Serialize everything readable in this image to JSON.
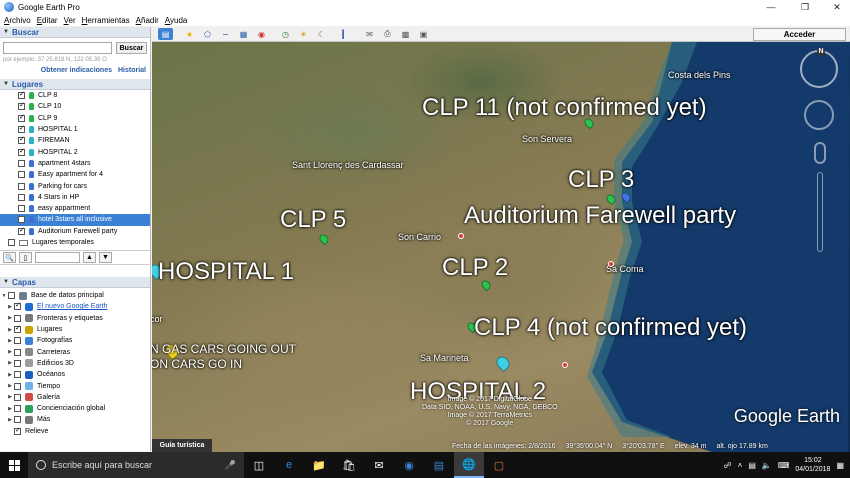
{
  "window": {
    "title": "Google Earth Pro"
  },
  "menu": [
    "Archivo",
    "Editar",
    "Ver",
    "Herramientas",
    "Añadir",
    "Ayuda"
  ],
  "search": {
    "header": "Buscar",
    "value": "",
    "button": "Buscar",
    "hint": "por ejemplo: 37 25.818 N, 122 05.36 O",
    "link_directions": "Obtener indicaciones",
    "link_history": "Historial"
  },
  "places": {
    "header": "Lugares",
    "items": [
      {
        "label": "CLP 8",
        "checked": true,
        "icon": "green-pin-icon"
      },
      {
        "label": "CLP 10",
        "checked": true,
        "icon": "green-pin-icon"
      },
      {
        "label": "CLP 9",
        "checked": true,
        "icon": "green-pin-icon"
      },
      {
        "label": "HOSPITAL 1",
        "checked": true,
        "icon": "teal-pin-icon"
      },
      {
        "label": "FIREMAN",
        "checked": true,
        "icon": "teal-pin-icon"
      },
      {
        "label": "HOSPITAL 2",
        "checked": true,
        "icon": "teal-pin-icon"
      },
      {
        "label": "apartment 4stars",
        "checked": false,
        "icon": "blue-pin-icon"
      },
      {
        "label": "Easy apartment for 4",
        "checked": false,
        "icon": "blue-pin-icon"
      },
      {
        "label": "Parking for cars",
        "checked": false,
        "icon": "blue-pin-icon"
      },
      {
        "label": "4 Stars in HP",
        "checked": false,
        "icon": "blue-pin-icon"
      },
      {
        "label": "easy appartment",
        "checked": false,
        "icon": "blue-pin-icon"
      },
      {
        "label": "hotel 3stars all inclusive",
        "checked": false,
        "icon": "blue-pin-icon",
        "selected": true
      },
      {
        "label": "Auditorium Farewell party",
        "checked": true,
        "icon": "blue-pin-icon"
      }
    ],
    "temp_folder": "Lugares temporales"
  },
  "layers": {
    "header": "Capas",
    "items": [
      {
        "label": "Base de datos principal",
        "checked": false,
        "icon": "database-icon",
        "link": false
      },
      {
        "label": "El nuevo Google Earth",
        "checked": true,
        "icon": "earth-icon",
        "link": true
      },
      {
        "label": "Fronteras y etiquetas",
        "checked": false,
        "icon": "borders-icon",
        "link": false
      },
      {
        "label": "Lugares",
        "checked": true,
        "icon": "places-icon",
        "link": false
      },
      {
        "label": "Fotografías",
        "checked": false,
        "icon": "photos-icon",
        "link": false
      },
      {
        "label": "Carreteras",
        "checked": false,
        "icon": "roads-icon",
        "link": false
      },
      {
        "label": "Edificios 3D",
        "checked": false,
        "icon": "buildings-icon",
        "link": false
      },
      {
        "label": "Océanos",
        "checked": false,
        "icon": "oceans-icon",
        "link": false
      },
      {
        "label": "Tiempo",
        "checked": false,
        "icon": "weather-icon",
        "link": false
      },
      {
        "label": "Galería",
        "checked": false,
        "icon": "gallery-icon",
        "link": false
      },
      {
        "label": "Concienciación global",
        "checked": false,
        "icon": "awareness-icon",
        "link": false
      },
      {
        "label": "Más",
        "checked": false,
        "icon": "more-icon",
        "link": false
      },
      {
        "label": "Relieve",
        "checked": true,
        "icon": "",
        "link": false
      }
    ]
  },
  "toolbar": {
    "signin": "Acceder"
  },
  "map": {
    "labels": {
      "clp11": "CLP 11 (not confirmed yet)",
      "clp3": "CLP 3",
      "auditorium": "Auditorium Farewell party",
      "clp5": "CLP 5",
      "hospital1": "HOSPITAL 1",
      "clp2": "CLP 2",
      "clp4": "CLP 4 (not confirmed yet)",
      "hospital2": "HOSPITAL 2",
      "cars_line1": "N GAS CARS GOING OUT",
      "cars_line2": "ON CARS GO IN",
      "fragment_cor": "cor"
    },
    "towns": {
      "costa": "Costa dels Pins",
      "son_servera": "Son Servera",
      "sant_llorenc": "Sant Llorenç des Cardassar",
      "son_carrio": "Son Carrio",
      "sa_coma": "Sa Coma",
      "sa_marineta": "Sa Marineta"
    },
    "attribution": [
      "Image © 2017 DigitalGlobe",
      "Data SIO, NOAA, U.S. Navy, NGA, GEBCO",
      "Image © 2017 TerraMetrics",
      "© 2017 Google"
    ],
    "logo": "Google Earth",
    "tour_guide": "Guía turística",
    "status": {
      "imagery_date": "Fecha de las imágenes: 2/8/2016",
      "lat": "39°35'00.04\" N",
      "lon": "3°20'03.78\" E",
      "elevation": "elev.   34 m",
      "eye_alt": "alt. ojo  17.89 km"
    },
    "compass_n": "N"
  },
  "taskbar": {
    "search_placeholder": "Escribe aquí para buscar",
    "time": "15:02",
    "date": "04/01/2018"
  }
}
